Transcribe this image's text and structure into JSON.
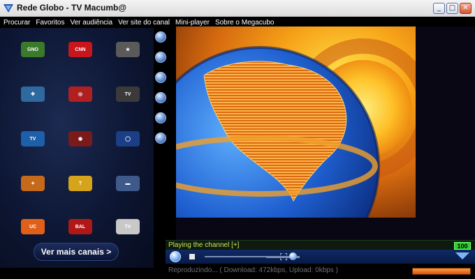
{
  "window": {
    "title": "Rede Globo - TV Macumb@",
    "minimize": "_",
    "maximize": "□",
    "close": "✕"
  },
  "menu": {
    "items": [
      "Procurar",
      "Favoritos",
      "Ver audiência",
      "Ver site do canal",
      "Mini-player",
      "Sobre o Megacubo"
    ]
  },
  "channels": {
    "logos": [
      {
        "text": "GNO",
        "color": "#3a7a2a",
        "icon": "channel-logo-green"
      },
      {
        "text": "CNN",
        "color": "#c8161d",
        "icon": "channel-logo-cnn"
      },
      {
        "text": "★",
        "color": "#5a5a5a",
        "icon": "channel-logo-star"
      },
      {
        "text": "✚",
        "color": "#2e6aa0",
        "icon": "channel-logo-cross"
      },
      {
        "text": "◎",
        "color": "#b02020",
        "icon": "channel-logo-ring"
      },
      {
        "text": "TV",
        "color": "#3a3a3a",
        "icon": "channel-logo-tv"
      },
      {
        "text": "TV",
        "color": "#1d5fa8",
        "icon": "channel-logo-globe"
      },
      {
        "text": "◉",
        "color": "#7a1a1a",
        "icon": "channel-logo-dot"
      },
      {
        "text": "◯",
        "color": "#1a3f86",
        "icon": "channel-logo-oval"
      },
      {
        "text": "✦",
        "color": "#c56a1a",
        "icon": "channel-logo-spark"
      },
      {
        "text": "T",
        "color": "#d6a41a",
        "icon": "channel-logo-t"
      },
      {
        "text": "▬",
        "color": "#3f5a8a",
        "icon": "channel-logo-bar"
      },
      {
        "text": "UC",
        "color": "#e0601a",
        "icon": "channel-logo-uc"
      },
      {
        "text": "BAL",
        "color": "#b01818",
        "icon": "channel-logo-bal"
      },
      {
        "text": "TV",
        "color": "#c8c8c8",
        "icon": "channel-logo-white"
      }
    ],
    "more_label": "Ver mais canais >"
  },
  "player": {
    "status": "Playing the channel [+]",
    "volume": "100",
    "volume_level": 0.8,
    "buffer_level": 1.0,
    "bottom_status": "Reproduzindo... ( Download: 472kbps, Upload: 0kbps )"
  },
  "colors": {
    "status_text": "#c9e85a",
    "accent_blue": "#1d4aa0",
    "volume_badge": "#2bd12b"
  }
}
